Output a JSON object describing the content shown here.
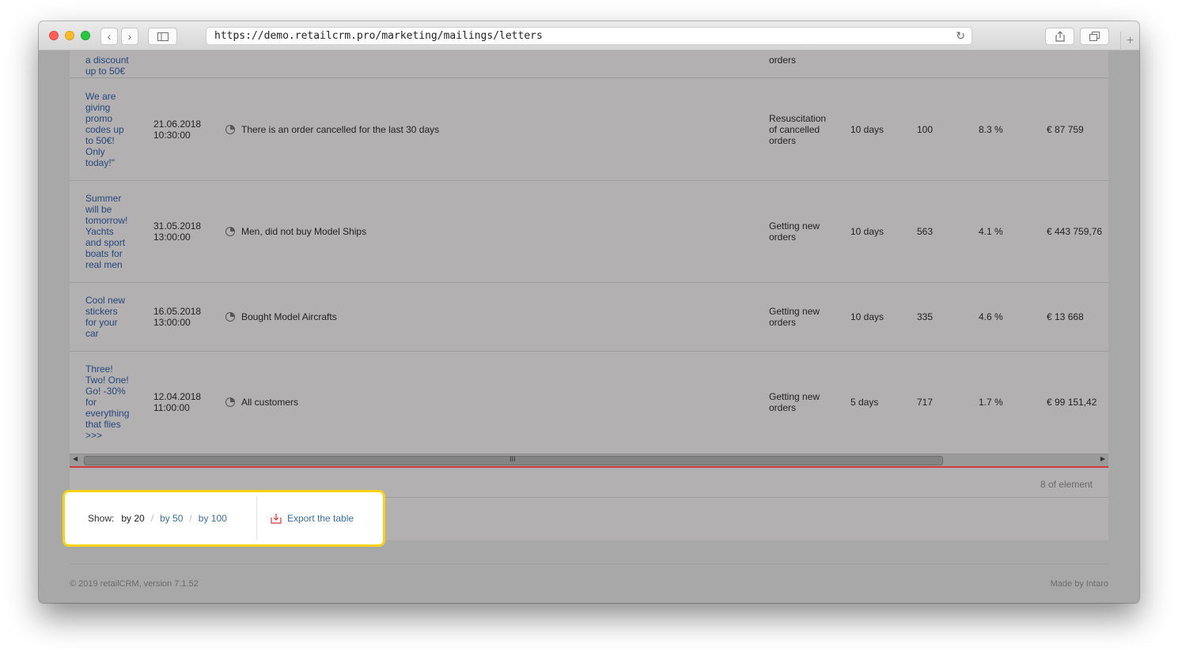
{
  "browser": {
    "url": "https://demo.retailcrm.pro/marketing/mailings/letters",
    "reload_icon": "↻",
    "plus_label": "+"
  },
  "rows": [
    {
      "name_lines": [
        "a discount",
        "up to 50€"
      ],
      "date": "",
      "time": "",
      "segment": "",
      "goal_lines": [
        "orders"
      ],
      "period": "",
      "sent": "",
      "rate": "",
      "revenue": ""
    },
    {
      "name_lines": [
        "We are",
        "giving",
        "promo",
        "codes up",
        "to 50€!",
        "Only",
        "today!\""
      ],
      "date": "21.06.2018",
      "time": "10:30:00",
      "segment": "There is an order cancelled for the last 30 days",
      "goal_lines": [
        "Resuscitation",
        "of cancelled",
        "orders"
      ],
      "period": "10 days",
      "sent": "100",
      "rate": "8.3 %",
      "revenue": "€ 87 759"
    },
    {
      "name_lines": [
        "Summer",
        "will be",
        "tomorrow!",
        "Yachts",
        "and sport",
        "boats for",
        "real men"
      ],
      "date": "31.05.2018",
      "time": "13:00:00",
      "segment": "Men, did not buy Model Ships",
      "goal_lines": [
        "Getting new",
        "orders"
      ],
      "period": "10 days",
      "sent": "563",
      "rate": "4.1 %",
      "revenue": "€ 443 759,76"
    },
    {
      "name_lines": [
        "Cool new",
        "stickers",
        "for your",
        "car"
      ],
      "date": "16.05.2018",
      "time": "13:00:00",
      "segment": "Bought Model Aircrafts",
      "goal_lines": [
        "Getting new",
        "orders"
      ],
      "period": "10 days",
      "sent": "335",
      "rate": "4.6 %",
      "revenue": "€ 13 668"
    },
    {
      "name_lines": [
        "Three!",
        "Two! One!",
        "Go! -30%",
        "for",
        "everything",
        "that flies",
        ">>>"
      ],
      "date": "12.04.2018",
      "time": "11:00:00",
      "segment": "All customers",
      "goal_lines": [
        "Getting new",
        "orders"
      ],
      "period": "5 days",
      "sent": "717",
      "rate": "1.7 %",
      "revenue": "€ 99 151,42"
    }
  ],
  "element_count": "8 of element",
  "pager": {
    "show_label": "Show:",
    "current": "by 20",
    "option_50": "by 50",
    "option_100": "by 100",
    "separator": "/"
  },
  "export_label": "Export the table",
  "footer": {
    "copyright": "© 2019 retailCRM, version 7.1.52",
    "made_by": "Made by Intaro"
  },
  "scrollbar_grip": "III",
  "colors": {
    "highlight": "#f5d216",
    "link": "#3a6ea5",
    "accent_line": "#d0393d"
  }
}
